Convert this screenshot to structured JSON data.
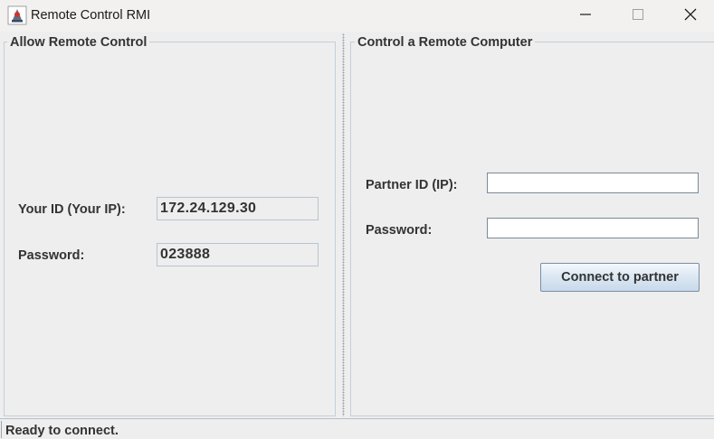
{
  "window": {
    "title": "Remote Control RMI",
    "app_icon": "java-cup-icon",
    "controls": [
      "minimize-icon",
      "maximize-icon",
      "close-icon"
    ]
  },
  "allow_panel": {
    "title": "Allow Remote Control",
    "id_label": "Your ID (Your IP):",
    "id_value": "172.24.129.30",
    "password_label": "Password:",
    "password_value": "023888"
  },
  "control_panel": {
    "title": "Control a Remote Computer",
    "partner_id_label": "Partner ID (IP):",
    "partner_id_value": "",
    "password_label": "Password:",
    "password_value": "",
    "connect_button": "Connect to partner"
  },
  "status": {
    "text": "Ready to connect."
  },
  "colors": {
    "background": "#eeeeee",
    "group_border": "#c3cfd9",
    "text": "#333333",
    "button_top": "#f4f8fc",
    "button_bottom": "#c8d9ea"
  }
}
